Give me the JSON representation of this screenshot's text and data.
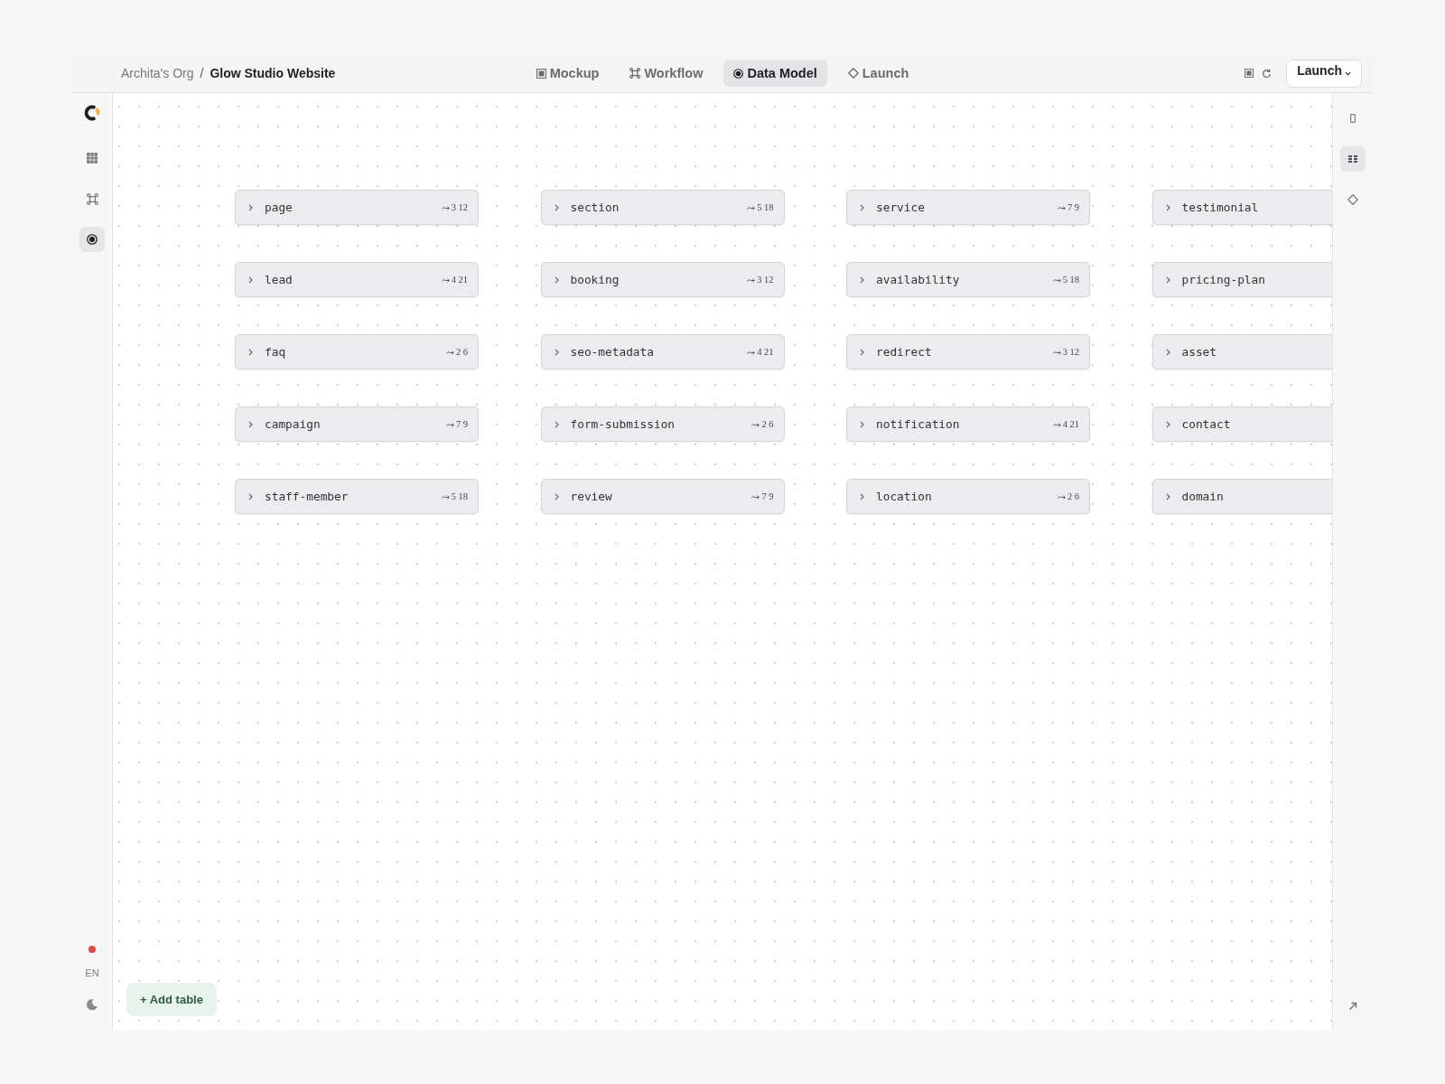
{
  "breadcrumb": {
    "org": "Archita's Org",
    "separator": "/",
    "project": "Glow Studio Website"
  },
  "tabs": [
    {
      "label": "Mockup",
      "kind": "mockup",
      "selected": false
    },
    {
      "label": "Workflow",
      "kind": "workflow",
      "selected": false
    },
    {
      "label": "Data Model",
      "kind": "data-model",
      "selected": true
    },
    {
      "label": "Launch",
      "kind": "launch",
      "selected": false
    }
  ],
  "launch_button": {
    "label": "Launch"
  },
  "left_sidebar": {
    "items": [
      {
        "kind": "mockup",
        "selected": false
      },
      {
        "kind": "workflow",
        "selected": false
      },
      {
        "kind": "data-model",
        "selected": true
      }
    ],
    "language": "EN"
  },
  "right_sidebar": {
    "items": [
      {
        "kind": "panel",
        "selected": false
      },
      {
        "kind": "list",
        "selected": true
      },
      {
        "kind": "shape",
        "selected": false
      }
    ]
  },
  "tables": [
    {
      "name": "page",
      "stats": "3 12"
    },
    {
      "name": "section",
      "stats": "5 18"
    },
    {
      "name": "service",
      "stats": "7 9"
    },
    {
      "name": "testimonial"
    },
    {
      "name": "lead",
      "stats": "4 21"
    },
    {
      "name": "booking",
      "stats": "3 12"
    },
    {
      "name": "availability",
      "stats": "5 18"
    },
    {
      "name": "pricing-plan"
    },
    {
      "name": "faq",
      "stats": "2 6"
    },
    {
      "name": "seo-metadata",
      "stats": "4 21"
    },
    {
      "name": "redirect",
      "stats": "3 12"
    },
    {
      "name": "asset"
    },
    {
      "name": "campaign",
      "stats": "7 9"
    },
    {
      "name": "form-submission",
      "stats": "2 6"
    },
    {
      "name": "notification",
      "stats": "4 21"
    },
    {
      "name": "contact"
    },
    {
      "name": "staff-member",
      "stats": "5 18"
    },
    {
      "name": "review",
      "stats": "7 9"
    },
    {
      "name": "location",
      "stats": "2 6"
    },
    {
      "name": "domain"
    }
  ],
  "add_table_button": {
    "label": "+ Add table"
  }
}
